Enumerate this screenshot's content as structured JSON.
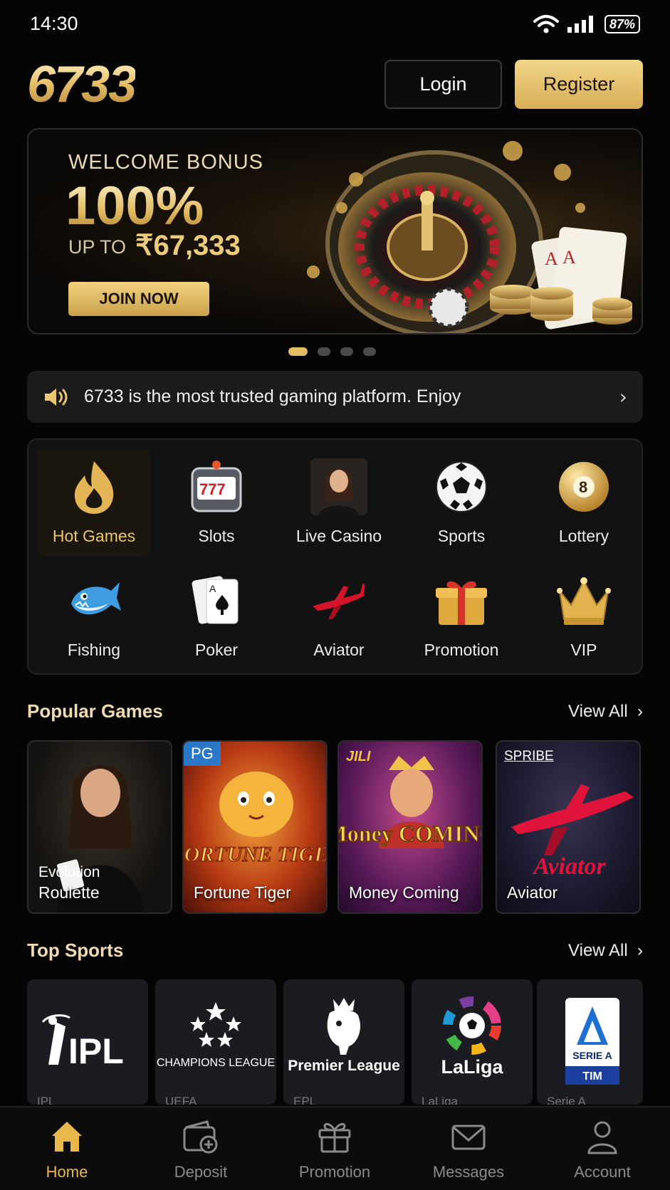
{
  "status_bar": {
    "time": "14:30",
    "battery": "87%"
  },
  "header": {
    "logo": "6733",
    "login_label": "Login",
    "register_label": "Register"
  },
  "banner": {
    "headline": "WELCOME BONUS",
    "percent": "100%",
    "up_to": "UP TO",
    "amount": "₹67,333",
    "cta_label": "JOIN NOW",
    "slides_total": 4,
    "active_slide": 1
  },
  "notice": {
    "text": "6733 is the most trusted gaming platform. Enjoy"
  },
  "categories": [
    {
      "label": "Hot Games",
      "icon": "flame-icon",
      "active": true
    },
    {
      "label": "Slots",
      "icon": "slot-machine-icon"
    },
    {
      "label": "Live Casino",
      "icon": "dealer-icon"
    },
    {
      "label": "Sports",
      "icon": "soccer-ball-icon"
    },
    {
      "label": "Lottery",
      "icon": "lottery-ball-icon"
    },
    {
      "label": "Fishing",
      "icon": "fish-icon"
    },
    {
      "label": "Poker",
      "icon": "playing-cards-icon"
    },
    {
      "label": "Aviator",
      "icon": "airplane-icon"
    },
    {
      "label": "Promotion",
      "icon": "gift-icon"
    },
    {
      "label": "VIP",
      "icon": "crown-icon"
    }
  ],
  "popular": {
    "title": "Popular Games",
    "view_all": "View All",
    "games": [
      {
        "title": "Roulette",
        "provider": "Evolution"
      },
      {
        "title": "Fortune Tiger",
        "provider": "PG",
        "art_text": "FORTUNE TIGER"
      },
      {
        "title": "Money Coming",
        "provider": "JILI",
        "art_text": "Money COMING"
      },
      {
        "title": "Aviator",
        "provider": "SPRIBE",
        "art_text": "Aviator"
      }
    ]
  },
  "sports": {
    "title": "Top Sports",
    "view_all": "View All",
    "leagues": [
      {
        "name": "IPL",
        "sub": "IPL"
      },
      {
        "name": "CHAMPIONS LEAGUE",
        "sub": "UEFA"
      },
      {
        "name": "Premier League",
        "sub": "EPL"
      },
      {
        "name": "LaLiga",
        "sub": "LaLiga"
      },
      {
        "name": "SERIE A",
        "sub": "Serie A",
        "sponsor": "TIM"
      }
    ]
  },
  "bottom_nav": [
    {
      "label": "Home",
      "icon": "home-icon",
      "active": true
    },
    {
      "label": "Deposit",
      "icon": "wallet-plus-icon"
    },
    {
      "label": "Promotion",
      "icon": "gift-icon"
    },
    {
      "label": "Messages",
      "icon": "envelope-icon"
    },
    {
      "label": "Account",
      "icon": "user-icon"
    }
  ],
  "colors": {
    "accent": "#e9c66f",
    "background": "#050505",
    "panel": "#121212",
    "active_nav": "#e9b84a"
  }
}
